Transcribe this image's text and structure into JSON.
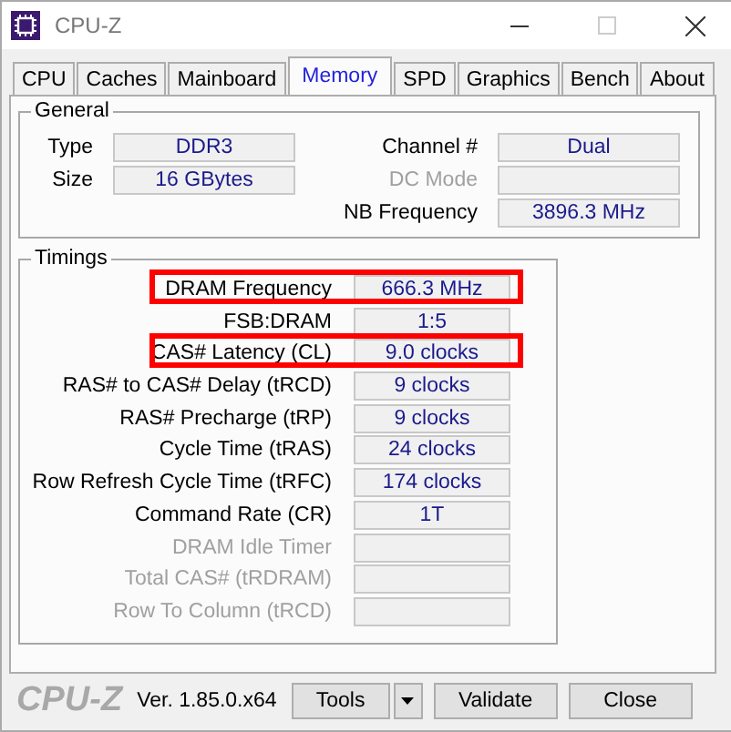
{
  "window": {
    "title": "CPU-Z"
  },
  "tabs": [
    {
      "label": "CPU",
      "selected": false
    },
    {
      "label": "Caches",
      "selected": false
    },
    {
      "label": "Mainboard",
      "selected": false
    },
    {
      "label": "Memory",
      "selected": true
    },
    {
      "label": "SPD",
      "selected": false
    },
    {
      "label": "Graphics",
      "selected": false
    },
    {
      "label": "Bench",
      "selected": false
    },
    {
      "label": "About",
      "selected": false
    }
  ],
  "general": {
    "title": "General",
    "left": [
      {
        "label": "Type",
        "value": "DDR3",
        "disabled": false
      },
      {
        "label": "Size",
        "value": "16 GBytes",
        "disabled": false
      }
    ],
    "right": [
      {
        "label": "Channel #",
        "value": "Dual",
        "disabled": false
      },
      {
        "label": "DC Mode",
        "disabled": true
      },
      {
        "label": "NB Frequency",
        "value": "3896.3 MHz",
        "disabled": false
      }
    ]
  },
  "timings": {
    "title": "Timings",
    "rows": [
      {
        "label": "DRAM Frequency",
        "value": "666.3 MHz",
        "disabled": false,
        "highlighted": true
      },
      {
        "label": "FSB:DRAM",
        "value": "1:5",
        "disabled": false,
        "highlighted": false
      },
      {
        "label": "CAS# Latency (CL)",
        "value": "9.0 clocks",
        "disabled": false,
        "highlighted": true
      },
      {
        "label": "RAS# to CAS# Delay (tRCD)",
        "value": "9 clocks",
        "disabled": false,
        "highlighted": false
      },
      {
        "label": "RAS# Precharge (tRP)",
        "value": "9 clocks",
        "disabled": false,
        "highlighted": false
      },
      {
        "label": "Cycle Time (tRAS)",
        "value": "24 clocks",
        "disabled": false,
        "highlighted": false
      },
      {
        "label": "Row Refresh Cycle Time (tRFC)",
        "value": "174 clocks",
        "disabled": false,
        "highlighted": false
      },
      {
        "label": "Command Rate (CR)",
        "value": "1T",
        "disabled": false,
        "highlighted": false
      },
      {
        "label": "DRAM Idle Timer",
        "disabled": true,
        "highlighted": false
      },
      {
        "label": "Total CAS# (tRDRAM)",
        "disabled": true,
        "highlighted": false
      },
      {
        "label": "Row To Column (tRCD)",
        "disabled": true,
        "highlighted": false
      }
    ]
  },
  "footer": {
    "logo": "CPU-Z",
    "version": "Ver. 1.85.0.x64",
    "buttons": [
      {
        "label": "Tools",
        "kind": "dropdown"
      },
      {
        "label": "Validate",
        "kind": "plain"
      },
      {
        "label": "Close",
        "kind": "plain"
      }
    ]
  }
}
